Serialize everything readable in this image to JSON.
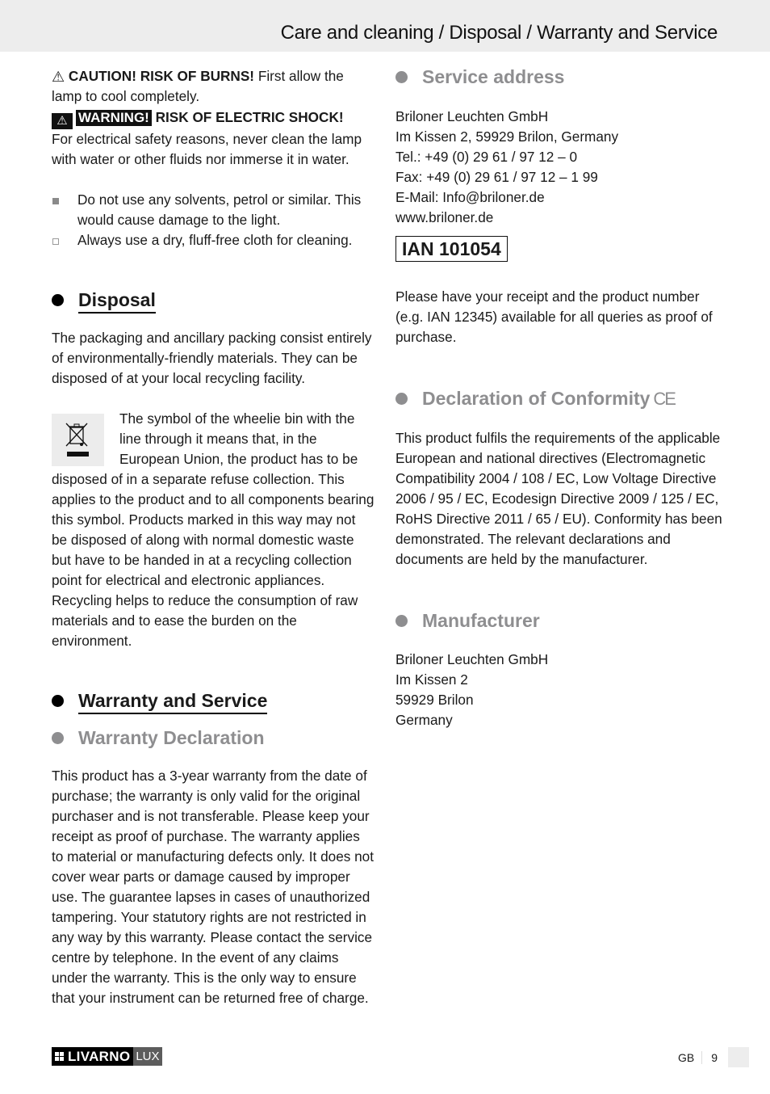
{
  "header": {
    "title": "Care and cleaning / Disposal / Warranty and Service"
  },
  "care": {
    "caution_label": "CAUTION! RISK OF BURNS!",
    "caution_text": " First allow the lamp to cool completely.",
    "warning_badge": "WARNING!",
    "warning_label": " RISK OF ELECTRIC SHOCK!",
    "warning_text": "For electrical safety reasons, never clean the lamp with water or other fluids nor immerse it in water.",
    "bullets": [
      {
        "style": "filled",
        "text": "Do not use any solvents, petrol or similar. This would cause damage to the light."
      },
      {
        "style": "empty",
        "text": "Always use a dry, fluff-free cloth for cleaning."
      }
    ]
  },
  "disposal": {
    "heading": "Disposal",
    "para1": "The packaging and ancillary packing consist entirely of environmentally-friendly materials. They can be disposed of at your local recycling facility.",
    "para2": "The symbol of the wheelie bin with the line through it means that, in the European Union, the product has to be disposed of in a separate refuse collection. This applies to the product and to all components bearing this symbol. Products marked in this way may not be disposed of along with normal domestic waste but have to be handed in at a recycling collection point for electrical and electronic appliances. Recycling helps to reduce the consumption of raw materials and to ease the burden on the environment."
  },
  "warranty": {
    "heading": "Warranty and Service",
    "declaration_heading": "Warranty Declaration",
    "declaration_text": "This product has a 3-year warranty from the date of purchase; the warranty is only valid for the original purchaser and is not transferable. Please keep your receipt as proof of purchase. The warranty applies to material or manufacturing defects only. It does not cover wear parts or damage caused by improper use. The guarantee lapses in cases of unauthorized tampering. Your statutory rights are not restricted in any way by this warranty. Please contact the service centre by telephone. In the event of any claims under the warranty. This is the only way to ensure that your instrument can be returned free of charge."
  },
  "service": {
    "heading": "Service address",
    "lines": [
      "Briloner Leuchten GmbH",
      "Im Kissen 2, 59929 Brilon, Germany",
      "Tel.: +49 (0) 29 61 / 97 12 – 0",
      "Fax: +49 (0) 29 61 / 97 12 – 1 99",
      "E-Mail: Info@briloner.de",
      "www.briloner.de"
    ],
    "ian": "IAN 101054",
    "receipt_note": "Please have your receipt and the product number (e.g. IAN 12345) available for all queries as proof of purchase."
  },
  "conformity": {
    "heading": "Declaration of Conformity",
    "ce_mark": "CE",
    "text": "This product fulfils the requirements of the applicable European and national directives (Electromagnetic Compatibility 2004 / 108 / EC, Low Voltage Directive 2006 / 95 / EC, Ecodesign Directive 2009 / 125 / EC, RoHS Directive 2011 / 65 / EU). Conformity has been demonstrated. The relevant declarations and documents are held by the manufacturer."
  },
  "manufacturer": {
    "heading": "Manufacturer",
    "lines": [
      "Briloner Leuchten GmbH",
      "Im Kissen 2",
      "59929 Brilon",
      "Germany"
    ]
  },
  "footer": {
    "logo_main": "LIVARNO",
    "logo_sub": "LUX",
    "lang": "GB",
    "page": "9"
  }
}
